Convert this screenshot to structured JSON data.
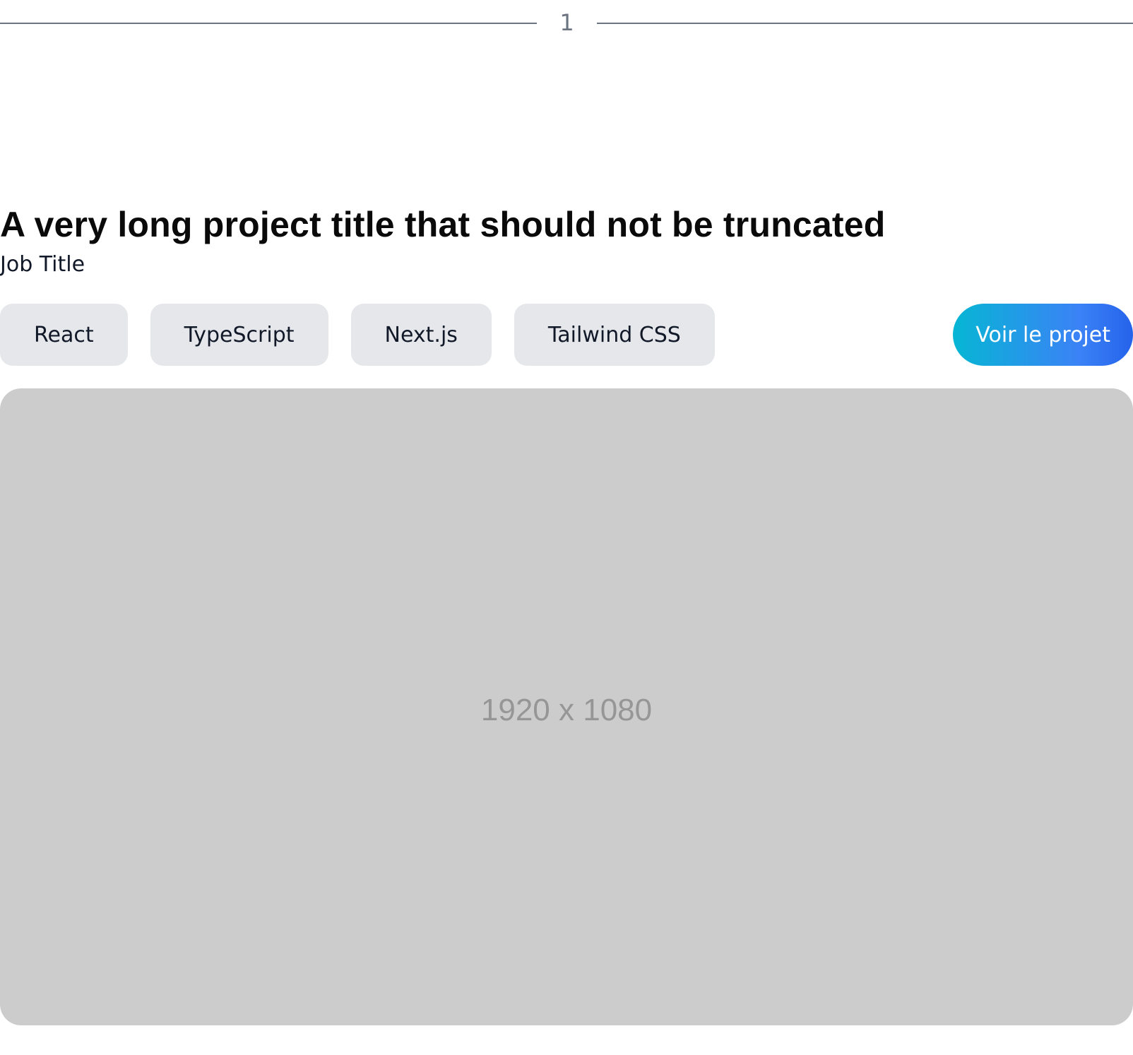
{
  "divider": {
    "number": "1"
  },
  "project": {
    "title": "A very long project title that should not be truncated",
    "job_title": "Job Title",
    "tags": [
      "React",
      "TypeScript",
      "Next.js",
      "Tailwind CSS"
    ],
    "cta_label": "Voir le projet",
    "image_placeholder": "1920 x 1080"
  },
  "colors": {
    "divider_line": "#6b7280",
    "tag_background": "#e5e7eb",
    "cta_gradient_start": "#06b6d4",
    "cta_gradient_end": "#2563eb",
    "placeholder_background": "#cccccc",
    "placeholder_text": "#969696"
  }
}
